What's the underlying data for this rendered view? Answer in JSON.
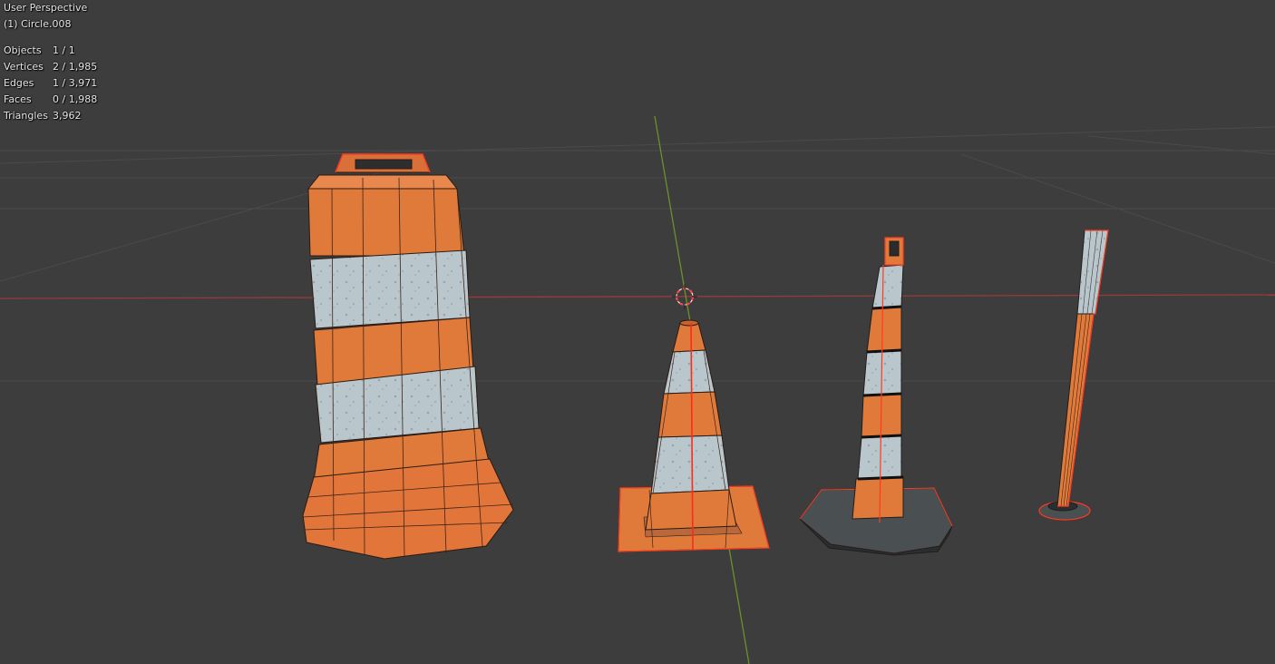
{
  "viewport": {
    "view_title": "User Perspective",
    "object_name": "(1) Circle.008",
    "stats": [
      {
        "label": "Objects",
        "value": "1 / 1"
      },
      {
        "label": "Vertices",
        "value": "2 / 1,985"
      },
      {
        "label": "Edges",
        "value": "1 / 3,971"
      },
      {
        "label": "Faces",
        "value": "0 / 1,988"
      },
      {
        "label": "Triangles",
        "value": "3,962"
      }
    ]
  },
  "colors": {
    "background": "#3d3d3d",
    "x_axis": "#9a3a3a",
    "y_axis": "#6e8f2a",
    "orange": "#e07a3a",
    "reflective": "#b9c6cc",
    "selection": "#ff3b1f",
    "base_dark": "#4a4f52"
  },
  "scene_objects": [
    {
      "name": "traffic-drum",
      "icon": "construction-drum"
    },
    {
      "name": "traffic-cone",
      "icon": "traffic-cone"
    },
    {
      "name": "channelizer-post",
      "icon": "delineator-post"
    },
    {
      "name": "flexible-bollard",
      "icon": "bollard-post"
    }
  ]
}
